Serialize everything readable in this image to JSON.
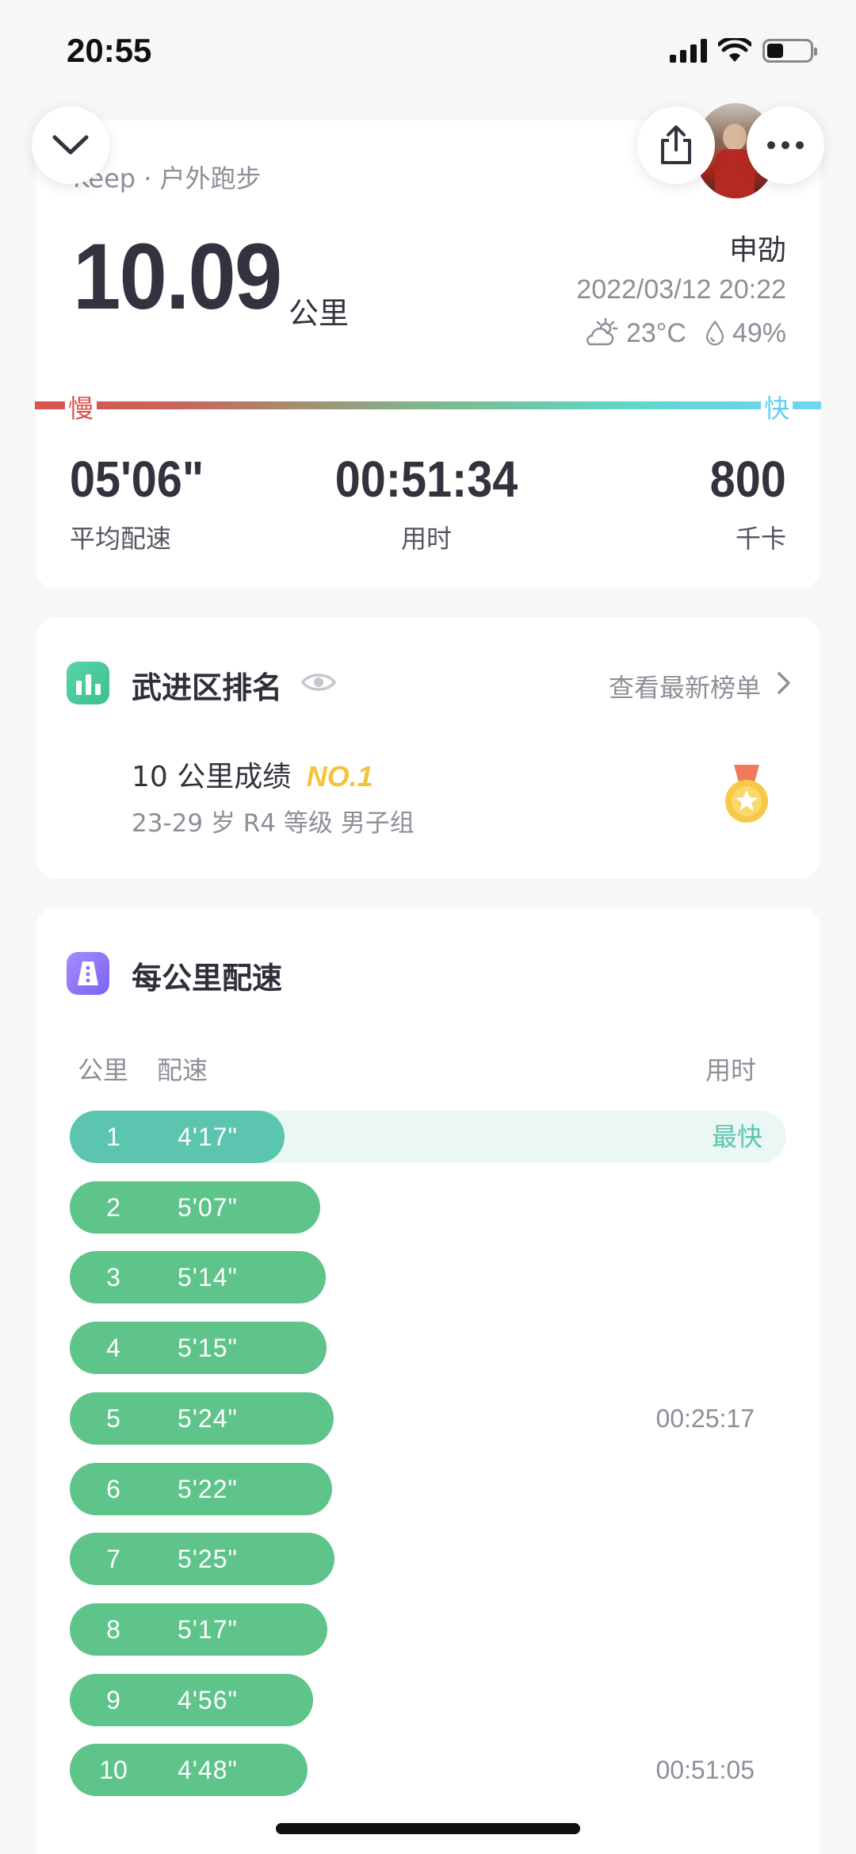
{
  "status_bar": {
    "time": "20:55"
  },
  "summary": {
    "source": "Keep · 户外跑步",
    "distance": "10.09",
    "distance_unit": "公里",
    "user_name": "申劭",
    "datetime": "2022/03/12 20:22",
    "temperature": "23°C",
    "humidity": "49%",
    "pace_scale": {
      "slow": "慢",
      "fast": "快"
    },
    "stats": [
      {
        "value": "05'06\"",
        "label": "平均配速"
      },
      {
        "value": "00:51:34",
        "label": "用时"
      },
      {
        "value": "800",
        "label": "千卡"
      }
    ]
  },
  "ranking": {
    "title": "武进区排名",
    "link_text": "查看最新榜单",
    "result_text": "10 公里成绩",
    "badge": "NO.1",
    "group_text": "23-29 岁 R4 等级 男子组"
  },
  "splits": {
    "title": "每公里配速",
    "headers": {
      "km": "公里",
      "pace": "配速",
      "time": "用时"
    },
    "fastest_label": "最快",
    "rows": [
      {
        "km": "1",
        "pace": "4'17\"",
        "bar_fraction": 0.3,
        "fastest": true,
        "time": ""
      },
      {
        "km": "2",
        "pace": "5'07\"",
        "bar_fraction": 0.35,
        "fastest": false,
        "time": ""
      },
      {
        "km": "3",
        "pace": "5'14\"",
        "bar_fraction": 0.357,
        "fastest": false,
        "time": ""
      },
      {
        "km": "4",
        "pace": "5'15\"",
        "bar_fraction": 0.358,
        "fastest": false,
        "time": ""
      },
      {
        "km": "5",
        "pace": "5'24\"",
        "bar_fraction": 0.368,
        "fastest": false,
        "time": "00:25:17"
      },
      {
        "km": "6",
        "pace": "5'22\"",
        "bar_fraction": 0.366,
        "fastest": false,
        "time": ""
      },
      {
        "km": "7",
        "pace": "5'25\"",
        "bar_fraction": 0.369,
        "fastest": false,
        "time": ""
      },
      {
        "km": "8",
        "pace": "5'17\"",
        "bar_fraction": 0.36,
        "fastest": false,
        "time": ""
      },
      {
        "km": "9",
        "pace": "4'56\"",
        "bar_fraction": 0.34,
        "fastest": false,
        "time": ""
      },
      {
        "km": "10",
        "pace": "4'48\"",
        "bar_fraction": 0.332,
        "fastest": false,
        "time": "00:51:05"
      }
    ]
  },
  "colors": {
    "split_bar": "#5ec48a",
    "split_fastest": "#5bc5b0",
    "badge": "#f2c43d",
    "slow": "#d9534f",
    "fast": "#5fd0f3"
  }
}
